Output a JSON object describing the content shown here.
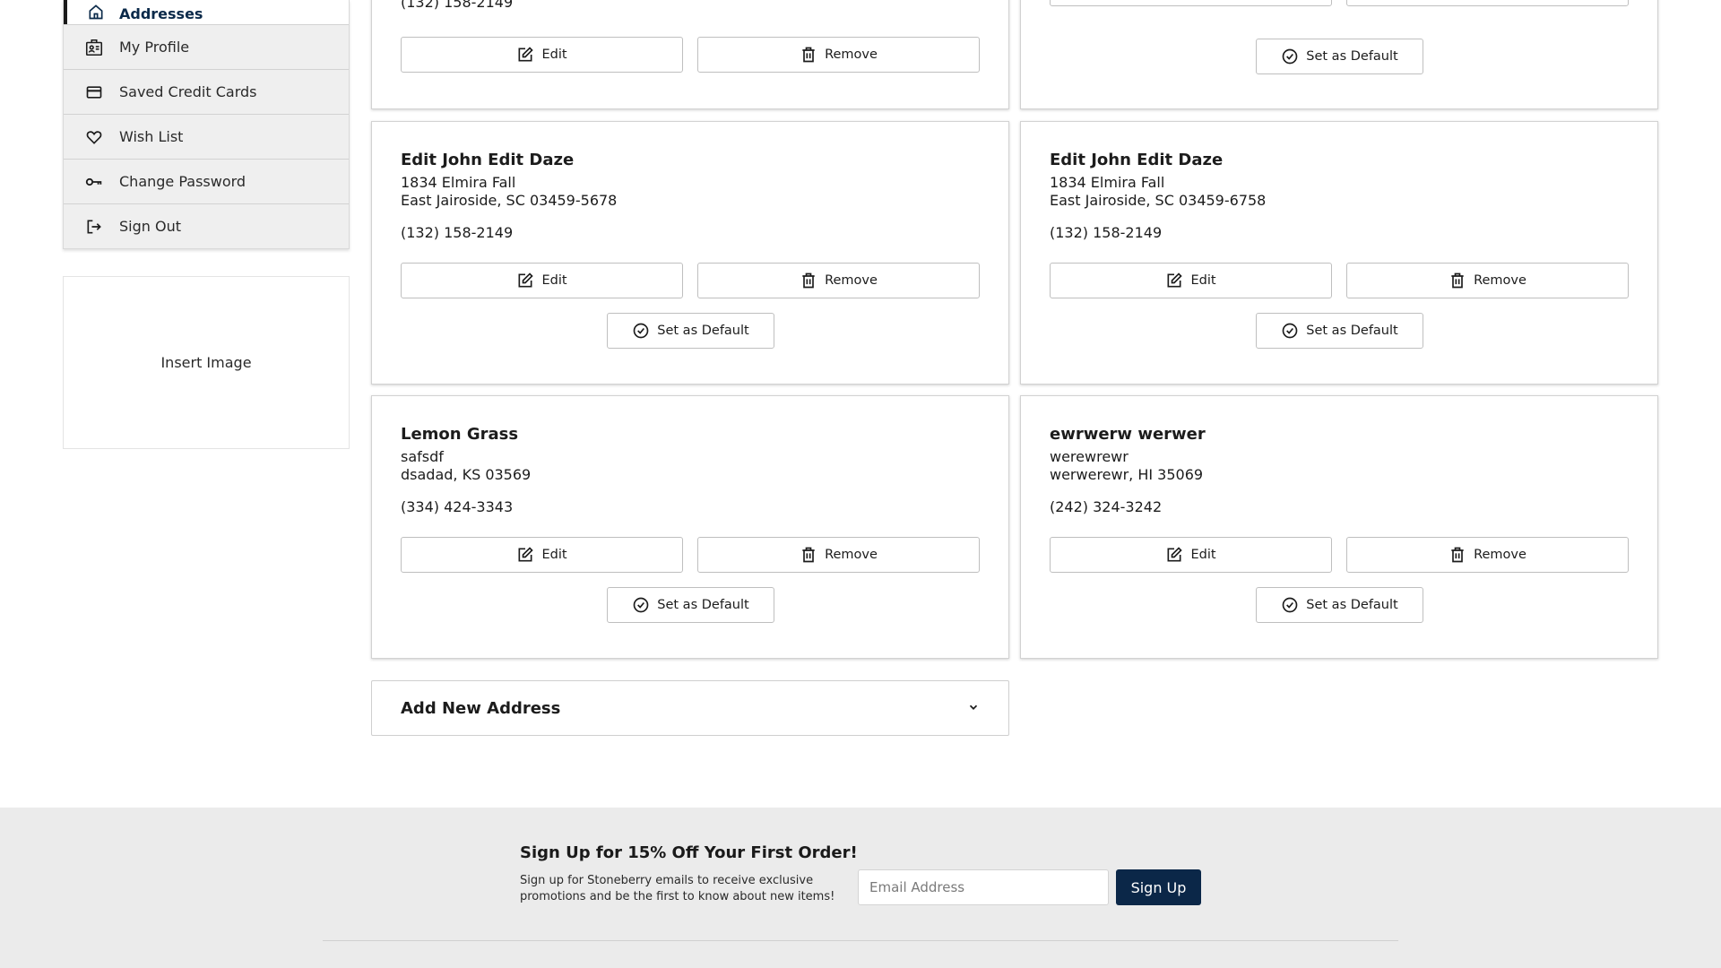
{
  "sidebar": {
    "items": [
      {
        "label": "Addresses",
        "icon": "home-icon"
      },
      {
        "label": "My Profile",
        "icon": "id-card-icon"
      },
      {
        "label": "Saved Credit Cards",
        "icon": "credit-card-icon"
      },
      {
        "label": "Wish List",
        "icon": "heart-icon"
      },
      {
        "label": "Change Password",
        "icon": "key-icon"
      },
      {
        "label": "Sign Out",
        "icon": "sign-out-icon"
      }
    ]
  },
  "insert_image": {
    "label": "Insert Image"
  },
  "buttons": {
    "edit": "Edit",
    "remove": "Remove",
    "set_default": "Set as Default"
  },
  "partial_cards": [
    {
      "phone": "(132) 158-2149"
    },
    {
      "phone": ""
    }
  ],
  "addresses": [
    {
      "name": "Edit John Edit Daze",
      "line1": "1834 Elmira Fall",
      "line2": "East Jairoside, SC 03459-5678",
      "phone": "(132) 158-2149"
    },
    {
      "name": "Edit John Edit Daze",
      "line1": "1834 Elmira Fall",
      "line2": "East Jairoside, SC 03459-6758",
      "phone": "(132) 158-2149"
    },
    {
      "name": "Lemon Grass",
      "line1": "safsdf",
      "line2": "dsadad, KS 03569",
      "phone": "(334) 424-3343"
    },
    {
      "name": "ewrwerw werwer",
      "line1": "werewrewr",
      "line2": "werwerewr, HI 35069",
      "phone": "(242) 324-3242"
    }
  ],
  "add_new": {
    "label": "Add New Address",
    "icon": "chevron-down-icon"
  },
  "footer": {
    "title": "Sign Up for 15% Off Your First Order!",
    "description": "Sign up for Stoneberry emails to receive exclusive promotions and be the first to know about new items!",
    "email_placeholder": "Email Address",
    "signup_label": "Sign Up",
    "brand_color": "#0b2748"
  }
}
